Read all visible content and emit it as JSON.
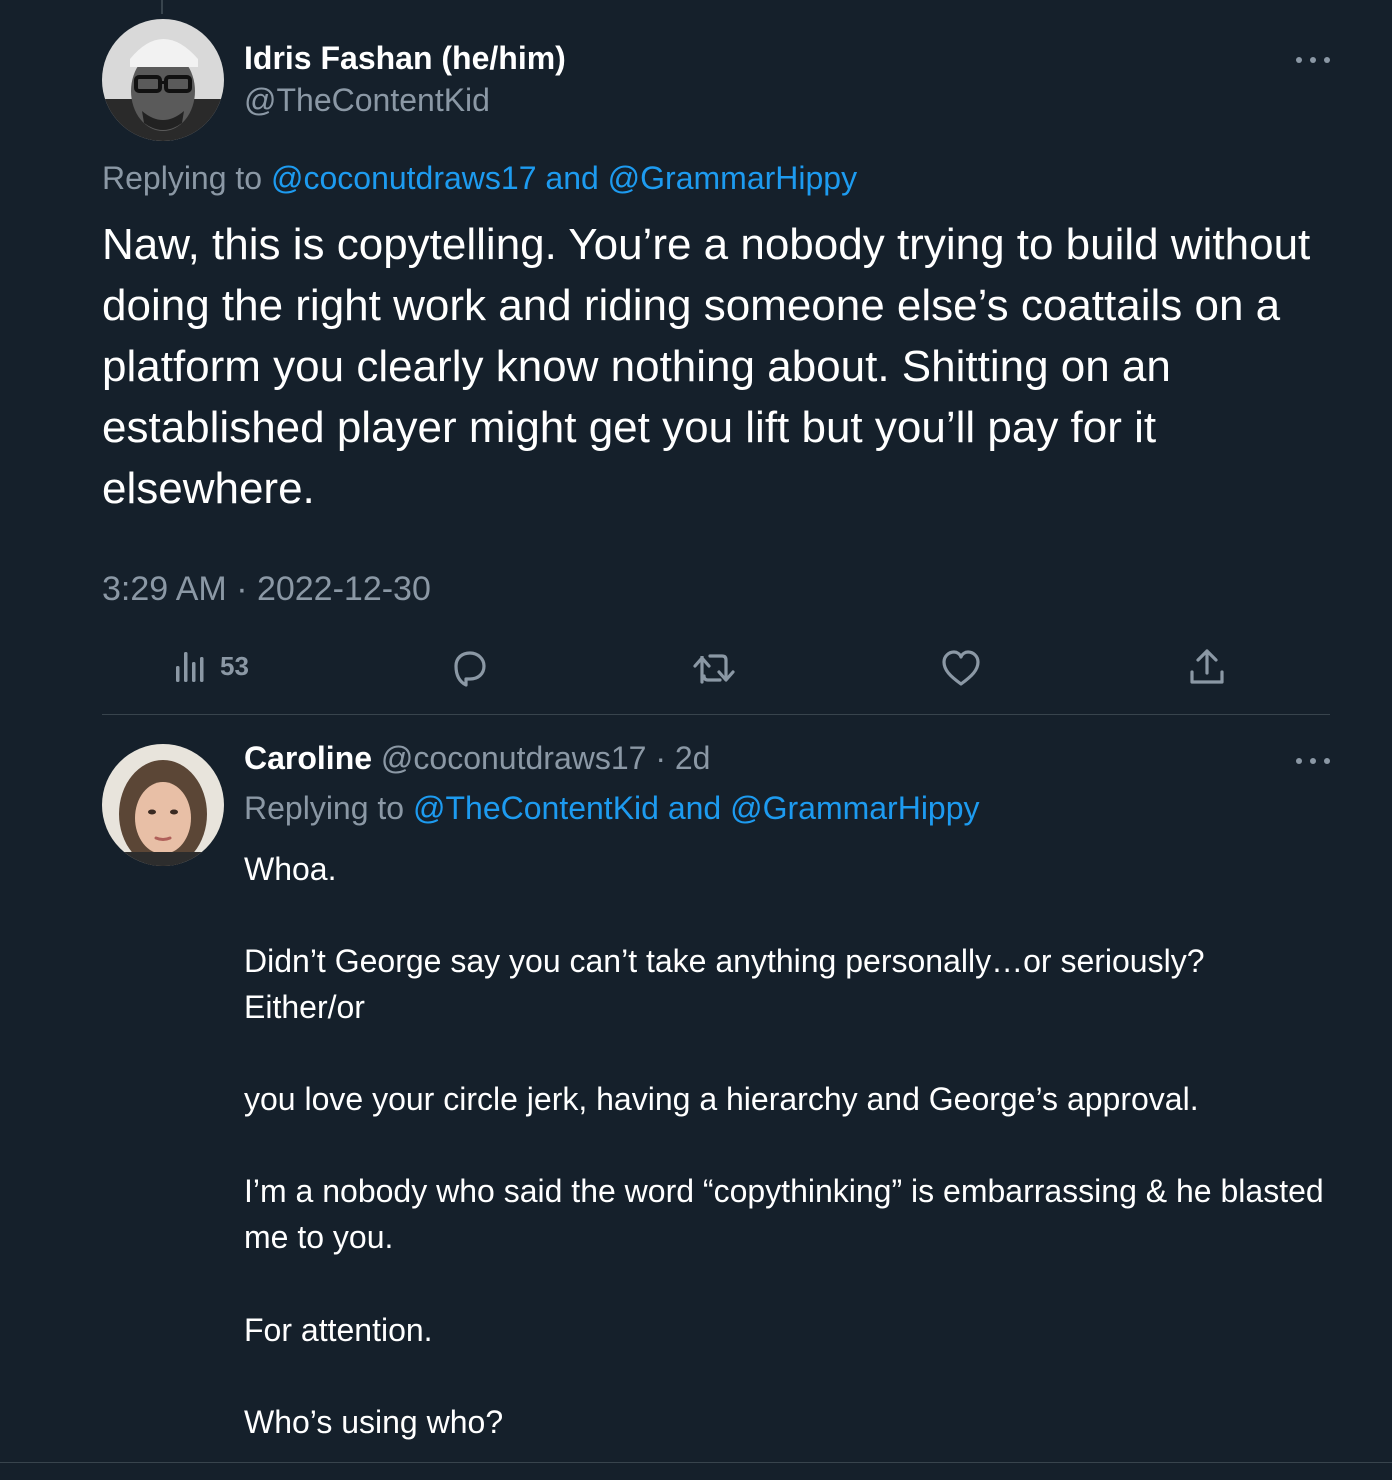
{
  "main_tweet": {
    "author_name": "Idris Fashan (he/him)",
    "handle": "@TheContentKid",
    "replying_prefix": "Replying to ",
    "replying_user1": "@coconutdraws17",
    "replying_and": " and ",
    "replying_user2": "@GrammarHippy",
    "text": "Naw, this is copytelling. You’re a nobody trying to build without doing the right work and riding someone else’s coattails on a platform you clearly know nothing about. Shitting on an established player might get you lift but you’ll pay for it elsewhere.",
    "timestamp": "3:29 AM · 2022-12-30",
    "views": "53"
  },
  "icons": {
    "more": "more-icon",
    "views": "views-icon",
    "reply": "reply-icon",
    "retweet": "retweet-icon",
    "like": "like-icon",
    "share": "share-icon"
  },
  "reply_tweet": {
    "author_name": "Caroline",
    "handle_time": " @coconutdraws17 · 2d",
    "replying_prefix": "Replying to ",
    "replying_user1": "@TheContentKid",
    "replying_and": " and ",
    "replying_user2": "@GrammarHippy",
    "paragraphs": [
      "Whoa.",
      "Didn’t George say you can’t take anything personally…or seriously? Either/or",
      "you love your circle jerk, having a hierarchy and George’s approval.",
      "I’m a nobody who said the word “copythinking” is embarrassing & he blasted me to you.",
      "For attention.",
      "Who’s using who?"
    ]
  },
  "colors": {
    "background": "#15202b",
    "text_primary": "#ffffff",
    "text_secondary": "#8b98a5",
    "link": "#1d9bf0",
    "divider": "#38444d"
  }
}
